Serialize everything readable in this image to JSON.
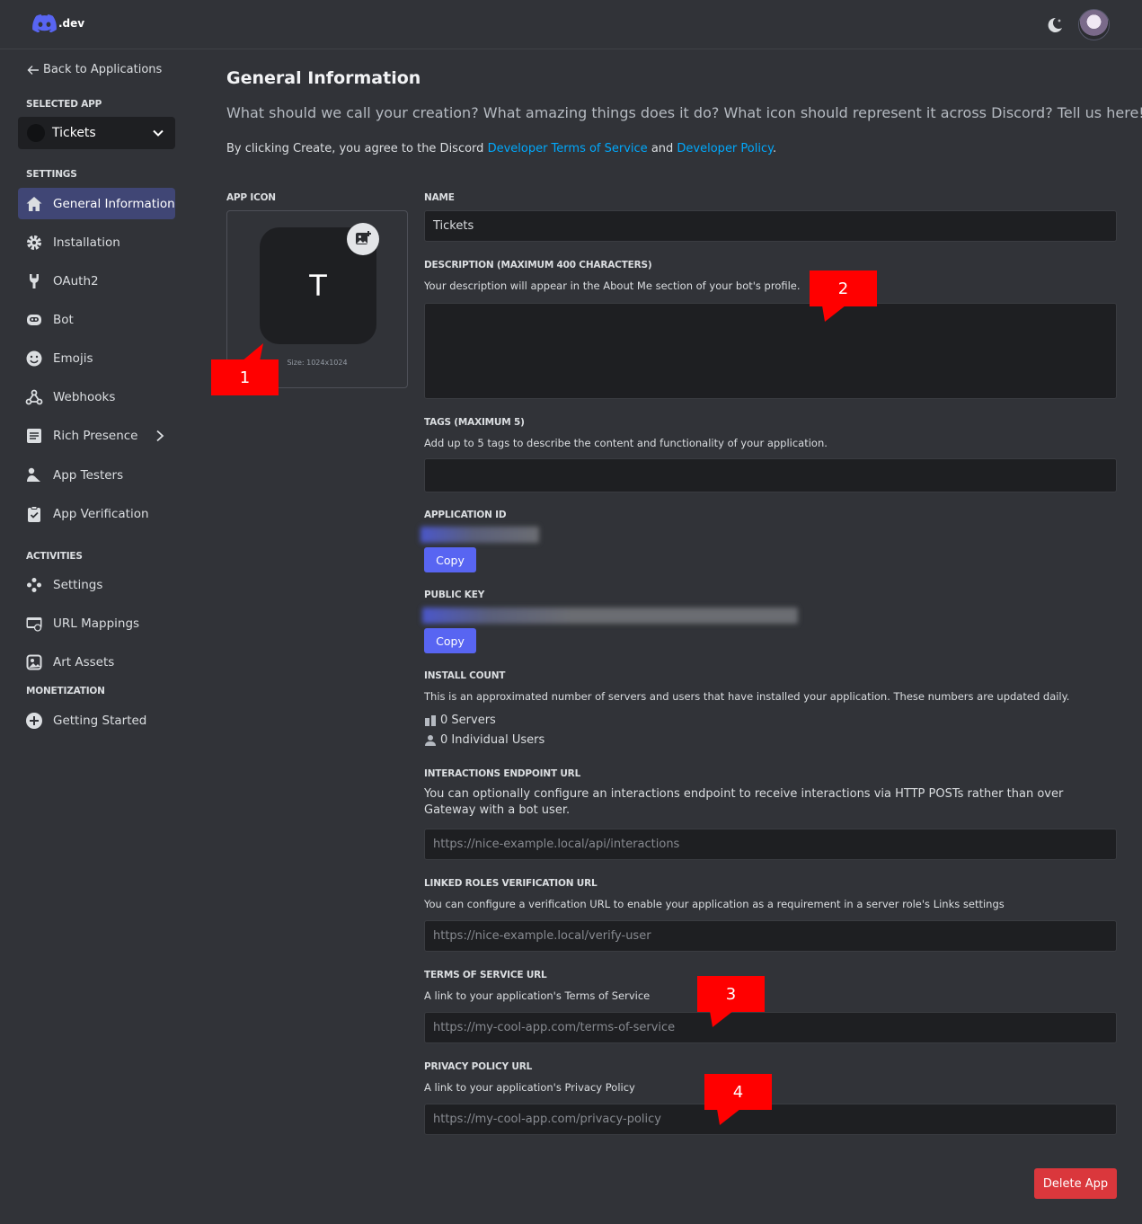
{
  "topbar": {
    "logo_text": ".dev"
  },
  "sidebar": {
    "back_label": "Back to Applications",
    "selected_app_label": "SELECTED APP",
    "selected_app_name": "Tickets",
    "settings_label": "SETTINGS",
    "settings_items": [
      {
        "label": "General Information",
        "icon": "home-icon"
      },
      {
        "label": "Installation",
        "icon": "gear-icon"
      },
      {
        "label": "OAuth2",
        "icon": "wrench-icon"
      },
      {
        "label": "Bot",
        "icon": "bot-icon"
      },
      {
        "label": "Emojis",
        "icon": "smile-icon"
      },
      {
        "label": "Webhooks",
        "icon": "webhook-icon"
      },
      {
        "label": "Rich Presence",
        "icon": "document-icon"
      },
      {
        "label": "App Testers",
        "icon": "user-icon"
      },
      {
        "label": "App Verification",
        "icon": "clipboard-check-icon"
      }
    ],
    "activities_label": "ACTIVITIES",
    "activities_items": [
      {
        "label": "Settings",
        "icon": "gamepad-icon"
      },
      {
        "label": "URL Mappings",
        "icon": "url-icon"
      },
      {
        "label": "Art Assets",
        "icon": "image-icon"
      }
    ],
    "monetization_label": "MONETIZATION",
    "monetization_items": [
      {
        "label": "Getting Started",
        "icon": "plus-circle-icon"
      }
    ]
  },
  "main": {
    "title": "General Information",
    "subtitle": "What should we call your creation? What amazing things does it do? What icon should represent it across Discord? Tell us here!",
    "agree_prefix": "By clicking Create, you agree to the Discord ",
    "tos_link": "Developer Terms of Service",
    "agree_and": " and ",
    "policy_link": "Developer Policy",
    "agree_suffix": ".",
    "app_icon_label": "APP ICON",
    "app_icon_letter": "T",
    "app_icon_size": "Size: 1024x1024",
    "name_label": "NAME",
    "name_value": "Tickets",
    "description_label": "DESCRIPTION (MAXIMUM 400 CHARACTERS)",
    "description_help": "Your description will appear in the About Me section of your bot's profile.",
    "tags_label": "TAGS (MAXIMUM 5)",
    "tags_help": "Add up to 5 tags to describe the content and functionality of your application.",
    "app_id_label": "APPLICATION ID",
    "public_key_label": "PUBLIC KEY",
    "copy_label": "Copy",
    "install_count_label": "INSTALL COUNT",
    "install_count_help": "This is an approximated number of servers and users that have installed your application. These numbers are updated daily.",
    "servers_count": "0 Servers",
    "users_count": "0 Individual Users",
    "interactions_label": "INTERACTIONS ENDPOINT URL",
    "interactions_help": "You can optionally configure an interactions endpoint to receive interactions via HTTP POSTs rather than over Gateway with a bot user.",
    "interactions_placeholder": "https://nice-example.local/api/interactions",
    "linked_roles_label": "LINKED ROLES VERIFICATION URL",
    "linked_roles_help": "You can configure a verification URL to enable your application as a requirement in a server role's Links settings",
    "linked_roles_placeholder": "https://nice-example.local/verify-user",
    "tos_label": "TERMS OF SERVICE URL",
    "tos_help": "A link to your application's Terms of Service",
    "tos_placeholder": "https://my-cool-app.com/terms-of-service",
    "privacy_label": "PRIVACY POLICY URL",
    "privacy_help": "A link to your application's Privacy Policy",
    "privacy_placeholder": "https://my-cool-app.com/privacy-policy",
    "delete_label": "Delete App"
  },
  "callouts": [
    "1",
    "2",
    "3",
    "4"
  ],
  "colors": {
    "accent": "#5865f2",
    "danger": "#da373c",
    "link": "#00a8fc",
    "callout": "#ff0000"
  }
}
